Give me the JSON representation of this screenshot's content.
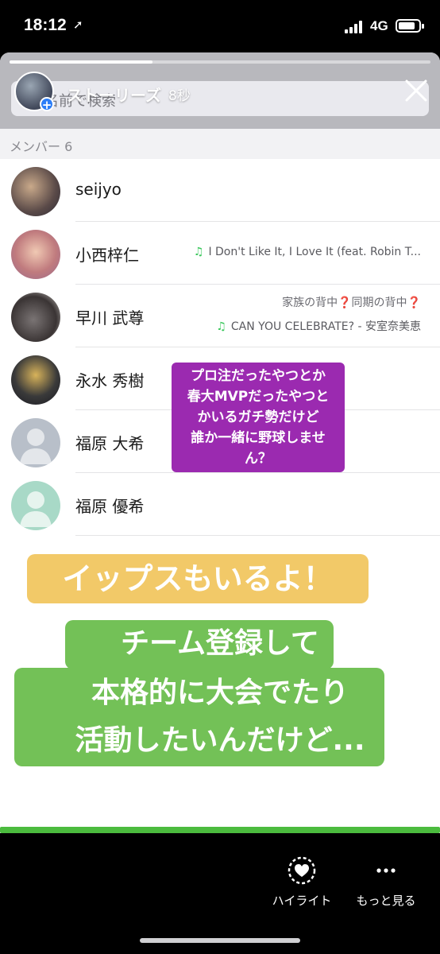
{
  "status_bar": {
    "time": "18:12",
    "network": "4G"
  },
  "story": {
    "title": "ストーリーズ",
    "elapsed": "8秒",
    "progress": 0.34
  },
  "search": {
    "placeholder": "名前で検索"
  },
  "members_section": {
    "header": "メンバー 6"
  },
  "members": [
    {
      "name": "seijyo",
      "status": "",
      "music": ""
    },
    {
      "name": "小西梓仁",
      "status": "",
      "music": "I Don't Like It, I Love It (feat. Robin T..."
    },
    {
      "name": "早川 武尊",
      "status": "家族の背中❓同期の背中❓",
      "music": "CAN YOU CELEBRATE? - 安室奈美恵"
    },
    {
      "name": "永水 秀樹",
      "status": "",
      "music": ""
    },
    {
      "name": "福原 大希",
      "status": "",
      "music": ""
    },
    {
      "name": "福原 優希",
      "status": "",
      "music": ""
    }
  ],
  "stickers": {
    "purple": [
      "プロ注だったやつとか",
      "春大MVPだったやつと",
      "かいるガチ勢だけど",
      "誰か一緒に野球しませ",
      "ん？"
    ],
    "yellow": "イップスもいるよ！",
    "green": [
      "チーム登録して",
      "本格的に大会でたり",
      "活動したいんだけど..."
    ]
  },
  "actions": {
    "highlight_label": "ハイライト",
    "more_label": "もっと見る"
  },
  "colors": {
    "purple_sticker": "#9b2ab0",
    "yellow_sticker": "#f2c968",
    "green_sticker": "#73c157",
    "music_note": "#38c75a",
    "progress_bar": "#4bbb3e"
  }
}
